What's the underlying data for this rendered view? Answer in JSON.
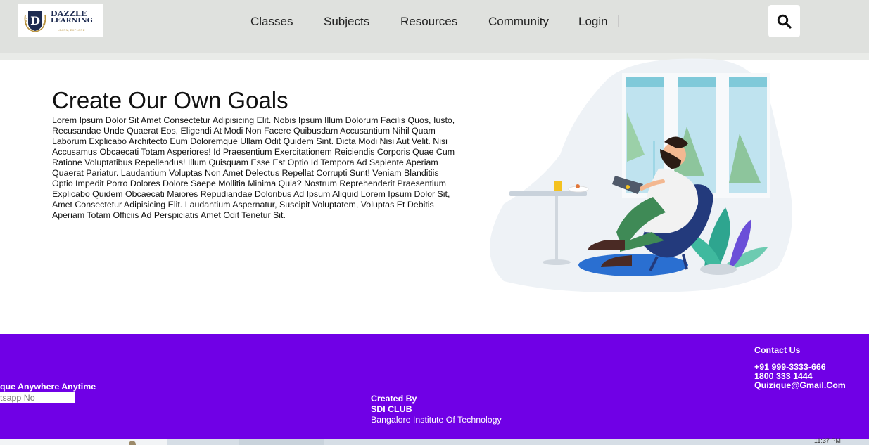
{
  "logo": {
    "title_line1": "DAZZLE",
    "title_line2": "LEARNING",
    "emblem_letter": "D",
    "tagline": "LEARN, EXPLORE"
  },
  "nav": {
    "items": [
      {
        "label": "Classes"
      },
      {
        "label": "Subjects"
      },
      {
        "label": "Resources"
      },
      {
        "label": "Community"
      },
      {
        "label": "Login"
      }
    ],
    "search_icon": "search-icon"
  },
  "hero": {
    "title": "Create Our Own Goals",
    "body": "Lorem Ipsum Dolor Sit Amet Consectetur Adipisicing Elit. Nobis Ipsum Illum Dolorum Facilis Quos, Iusto, Recusandae Unde Quaerat Eos, Eligendi At Modi Non Facere Quibusdam Accusantium Nihil Quam Laborum Explicabo Architecto Eum Doloremque Ullam Odit Quidem Sint. Dicta Modi Nisi Aut Velit. Nisi Accusamus Obcaecati Totam Asperiores! Id Praesentium Exercitationem Reiciendis Corporis Quae Cum Ratione Voluptatibus Repellendus! Illum Quisquam Esse Est Optio Id Tempora Ad Sapiente Aperiam Quaerat Pariatur. Laudantium Voluptas Non Amet Delectus Repellat Corrupti Sunt! Veniam Blanditiis Optio Impedit Porro Dolores Dolore Saepe Mollitia Minima Quia? Nostrum Reprehenderit Praesentium Explicabo Quidem Obcaecati Maiores Repudiandae Doloribus Ad Ipsum Aliquid Lorem Ipsum Dolor Sit, Amet Consectetur Adipisicing Elit. Laudantium Aspernatur, Suscipit Voluptatem, Voluptas Et Debitis Aperiam Totam Officiis Ad Perspiciatis Amet Odit Tenetur Sit."
  },
  "footer": {
    "tagline": "que Anywhere Anytime",
    "whatsapp_placeholder": "tsapp No",
    "created_by_label": "Created By",
    "club_name": "SDI CLUB",
    "institute": "Bangalore Institute Of Technology",
    "contact_heading": "Contact Us",
    "phone_1": "+91 999-3333-666",
    "phone_2": "1800 333 1444",
    "email": "Quizique@Gmail.Com"
  },
  "taskbar": {
    "clock": "11:37 PM"
  },
  "colors": {
    "header_bg": "#dfe1de",
    "footer_bg": "#7000e6",
    "logo_navy": "#1d2b50",
    "logo_gold": "#b8923e"
  }
}
